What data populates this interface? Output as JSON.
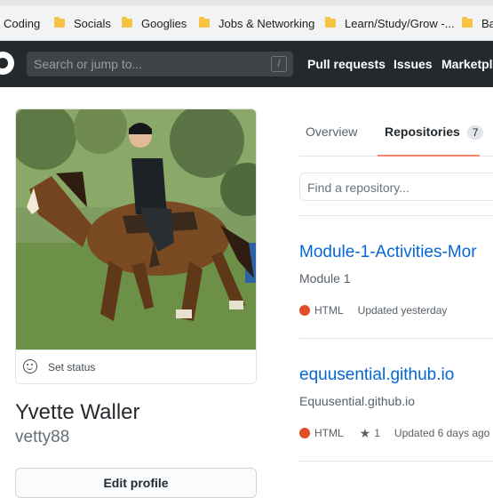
{
  "bookmarks": [
    {
      "label": "Coding",
      "has_folder": false
    },
    {
      "label": "Socials",
      "has_folder": true
    },
    {
      "label": "Googlies",
      "has_folder": true
    },
    {
      "label": "Jobs & Networking",
      "has_folder": true
    },
    {
      "label": "Learn/Study/Grow -...",
      "has_folder": true
    },
    {
      "label": "Ba",
      "has_folder": true
    }
  ],
  "header": {
    "search_placeholder": "Search or jump to...",
    "search_shortcut": "/",
    "nav": [
      "Pull requests",
      "Issues",
      "Marketpl"
    ]
  },
  "profile": {
    "status": "Set status",
    "name": "Yvette Waller",
    "username": "vetty88",
    "edit_button": "Edit profile"
  },
  "tabs": {
    "overview": "Overview",
    "repositories": "Repositories",
    "repositories_count": "7"
  },
  "find_placeholder": "Find a repository...",
  "repos": [
    {
      "name": "Module-1-Activities-Mor",
      "description": "Module 1",
      "language": "HTML",
      "language_color": "#e34c26",
      "stars": "",
      "updated": "Updated yesterday"
    },
    {
      "name": "equusential.github.io",
      "description": "Equusential.github.io",
      "language": "HTML",
      "language_color": "#e34c26",
      "stars": "1",
      "updated": "Updated 6 days ago"
    }
  ]
}
